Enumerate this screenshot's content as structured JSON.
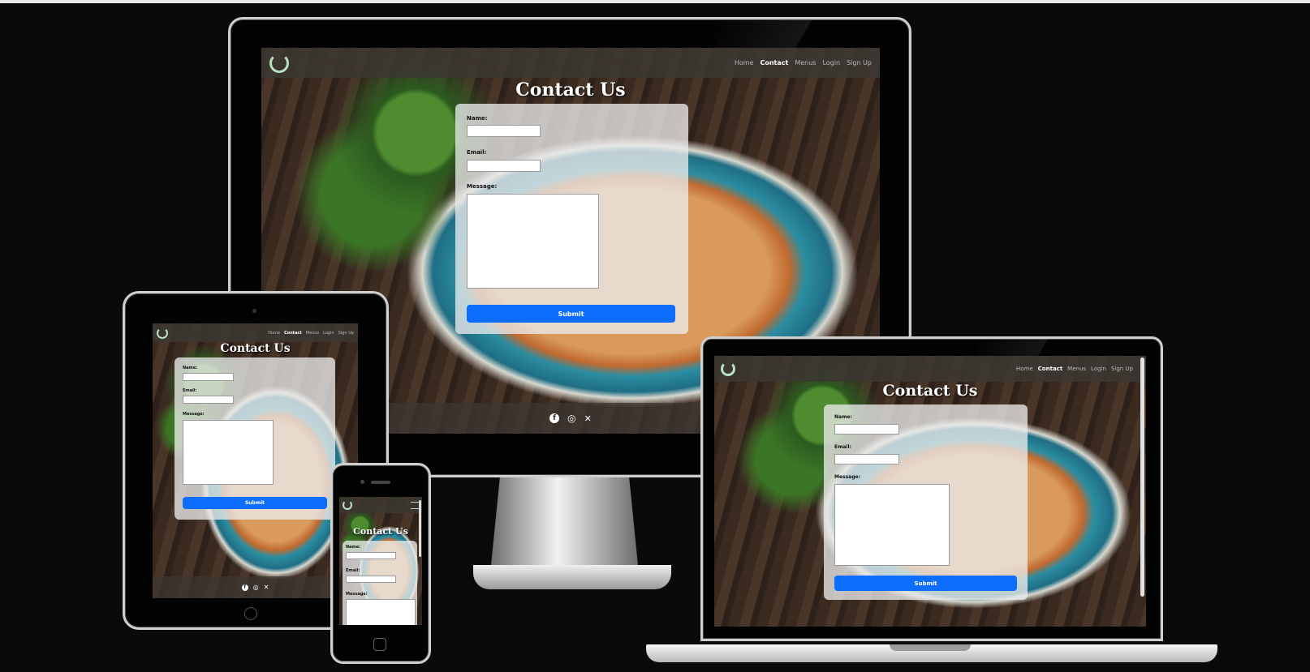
{
  "nav": {
    "logo_icon": "power-ring-icon",
    "links": [
      "Home",
      "Contact",
      "Menus",
      "Login",
      "Sign Up"
    ],
    "active": "Contact"
  },
  "page": {
    "title": "Contact Us",
    "name_label": "Name:",
    "email_label": "Email:",
    "message_label": "Message:",
    "submit_label": "Submit"
  },
  "footer": {
    "social_icons": [
      "facebook-icon",
      "instagram-icon",
      "x-icon"
    ],
    "glyphs": [
      "f",
      "◎",
      "✕"
    ]
  },
  "colors": {
    "accent": "#0d6efd",
    "background": "#0b0a0b",
    "logo": "#b9e1c3"
  }
}
